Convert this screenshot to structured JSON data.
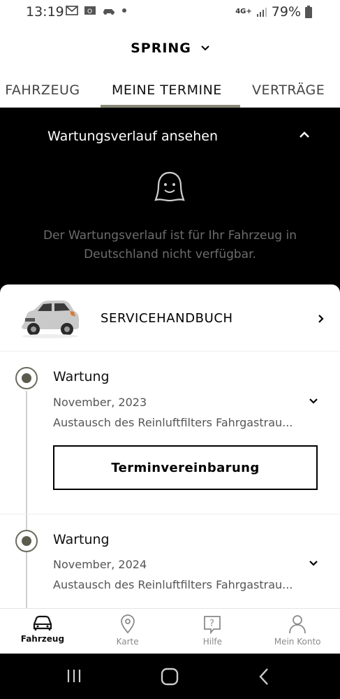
{
  "status_bar": {
    "time": "13:19",
    "network": "4G+",
    "battery": "79%"
  },
  "header": {
    "vehicle_name": "SPRING"
  },
  "tabs": [
    {
      "label": "MEIN FAHRZEUG",
      "visible_label": "N FAHRZEUG",
      "active": false
    },
    {
      "label": "MEINE TERMINE",
      "visible_label": "MEINE TERMINE",
      "active": true
    },
    {
      "label": "VERTRÄGE",
      "visible_label": "VERTRÄGE",
      "active": false
    }
  ],
  "history": {
    "title": "Wartungsverlauf ansehen",
    "message": "Der Wartungsverlauf ist für Ihr Fahrzeug in Deutschland nicht verfügbar."
  },
  "handbook": {
    "label": "SERVICEHANDBUCH"
  },
  "maintenance": [
    {
      "title": "Wartung",
      "date": "November, 2023",
      "description": "Austausch des Reinluftfilters Fahrgastrau...",
      "button": "Terminvereinbarung"
    },
    {
      "title": "Wartung",
      "date": "November, 2024",
      "description": "Austausch des Reinluftfilters Fahrgastrau..."
    }
  ],
  "bottom_nav": [
    {
      "label": "Fahrzeug",
      "icon": "car-icon",
      "active": true
    },
    {
      "label": "Karte",
      "icon": "map-pin-icon",
      "active": false
    },
    {
      "label": "Hilfe",
      "icon": "help-icon",
      "active": false
    },
    {
      "label": "Mein Konto",
      "icon": "user-icon",
      "active": false
    }
  ],
  "colors": {
    "accent": "#8a8a78",
    "timeline_dot": "#5c5c4e",
    "dark_section": "#000000",
    "muted_text": "#6d6d6d"
  }
}
